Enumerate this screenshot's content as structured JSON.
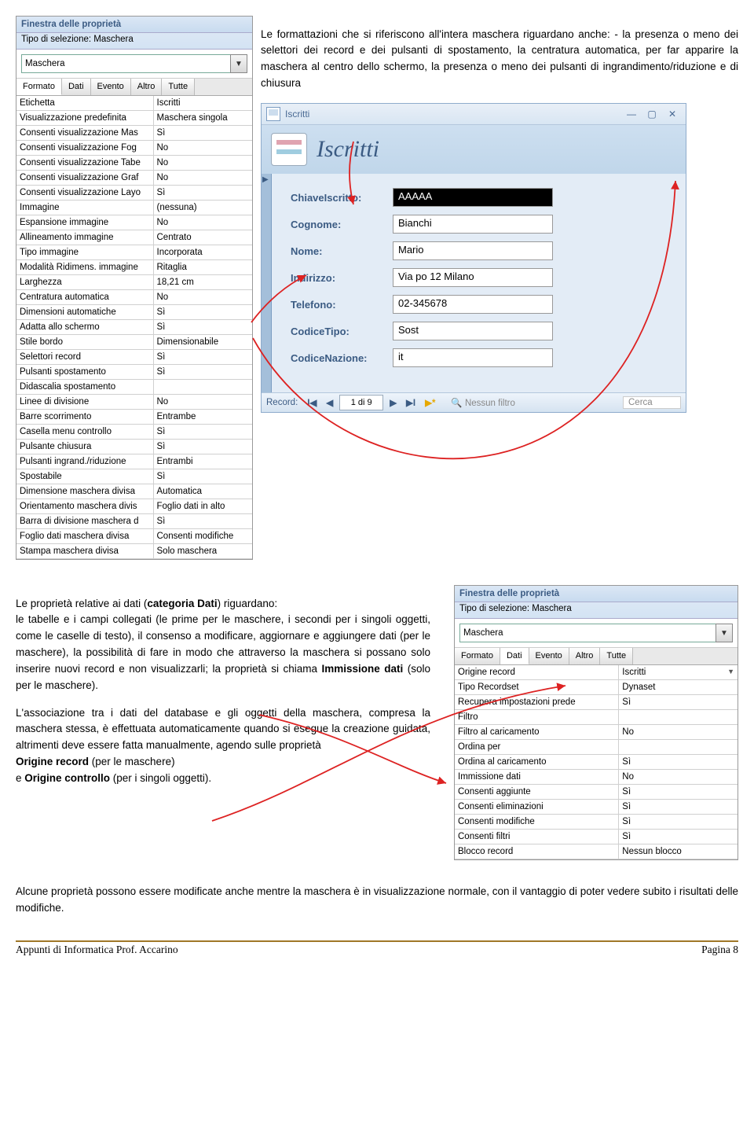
{
  "prop1": {
    "title": "Finestra delle proprietà",
    "subtitle": "Tipo di selezione:  Maschera",
    "select_value": "Maschera",
    "tabs": [
      "Formato",
      "Dati",
      "Evento",
      "Altro",
      "Tutte"
    ],
    "active_tab": 0,
    "rows": [
      [
        "Etichetta",
        "Iscritti"
      ],
      [
        "Visualizzazione predefinita",
        "Maschera singola"
      ],
      [
        "Consenti visualizzazione Mas",
        "Sì"
      ],
      [
        "Consenti visualizzazione Fog",
        "No"
      ],
      [
        "Consenti visualizzazione Tabe",
        "No"
      ],
      [
        "Consenti visualizzazione Graf",
        "No"
      ],
      [
        "Consenti visualizzazione Layo",
        "Sì"
      ],
      [
        "Immagine",
        "(nessuna)"
      ],
      [
        "Espansione immagine",
        "No"
      ],
      [
        "Allineamento immagine",
        "Centrato"
      ],
      [
        "Tipo immagine",
        "Incorporata"
      ],
      [
        "Modalità Ridimens. immagine",
        "Ritaglia"
      ],
      [
        "Larghezza",
        "18,21 cm"
      ],
      [
        "Centratura automatica",
        "No"
      ],
      [
        "Dimensioni automatiche",
        "Sì"
      ],
      [
        "Adatta allo schermo",
        "Sì"
      ],
      [
        "Stile bordo",
        "Dimensionabile"
      ],
      [
        "Selettori record",
        "Sì"
      ],
      [
        "Pulsanti spostamento",
        "Sì"
      ],
      [
        "Didascalia spostamento",
        ""
      ],
      [
        "Linee di divisione",
        "No"
      ],
      [
        "Barre scorrimento",
        "Entrambe"
      ],
      [
        "Casella menu controllo",
        "Sì"
      ],
      [
        "Pulsante chiusura",
        "Sì"
      ],
      [
        "Pulsanti ingrand./riduzione",
        "Entrambi"
      ],
      [
        "Spostabile",
        "Sì"
      ],
      [
        "Dimensione maschera divisa",
        "Automatica"
      ],
      [
        "Orientamento maschera divis",
        "Foglio dati in alto"
      ],
      [
        "Barra di divisione maschera d",
        "Sì"
      ],
      [
        "Foglio dati maschera divisa",
        "Consenti modifiche"
      ],
      [
        "Stampa maschera divisa",
        "Solo maschera"
      ]
    ]
  },
  "para1": "Le formattazioni che si riferiscono all'intera maschera riguardano anche: - la presenza o meno dei selettori dei record e dei pulsanti di spostamento, la centratura automatica, per far apparire la maschera al centro dello schermo, la presenza o meno dei pulsanti di ingrandimento/riduzione e di chiusura",
  "form": {
    "tab_title": "Iscritti",
    "header_title": "Iscritti",
    "fields": [
      {
        "label": "ChiaveIscritto:",
        "value": "AAAAA",
        "highlight": true
      },
      {
        "label": "Cognome:",
        "value": "Bianchi"
      },
      {
        "label": "Nome:",
        "value": "Mario"
      },
      {
        "label": "Indirizzo:",
        "value": "Via po 12 Milano"
      },
      {
        "label": "Telefono:",
        "value": "02-345678"
      },
      {
        "label": "CodiceTipo:",
        "value": "Sost"
      },
      {
        "label": "CodiceNazione:",
        "value": "it"
      }
    ],
    "record_label": "Record:",
    "record_pos": "1 di 9",
    "filter_label": "Nessun filtro",
    "search_label": "Cerca"
  },
  "para2_a": "Le proprietà relative ai dati (",
  "para2_b": "categoria Dati",
  "para2_c": ") riguardano:",
  "para2_2": "le tabelle e i campi collegati (le prime per le maschere, i secondi per i singoli oggetti, come le caselle di testo), il consenso a modificare, aggiornare e aggiungere dati (per le maschere), la possibilità di fare in modo che attraverso la maschera si possano solo inserire nuovi record e non visualizzarli; la proprietà si chiama ",
  "para2_2b": "Immissione dati",
  "para2_2c": " (solo per le maschere).",
  "para3_a": "L'associazione tra i dati del database e gli oggetti della maschera, compresa la maschera stessa, è effettuata automaticamente quando si esegue la creazione guidata, altrimenti deve essere fatta manualmente, agendo sulle proprietà",
  "para3_b": "Origine record",
  "para3_c": " (per le maschere)",
  "para3_d": "e ",
  "para3_e": "Origine controllo",
  "para3_f": " (per i singoli oggetti).",
  "para4": "Alcune proprietà possono essere modificate anche mentre la maschera è in visualizzazione normale, con il vantaggio di poter vedere subito i risultati delle modifiche.",
  "prop2": {
    "title": "Finestra delle proprietà",
    "subtitle": "Tipo di selezione:  Maschera",
    "select_value": "Maschera",
    "tabs": [
      "Formato",
      "Dati",
      "Evento",
      "Altro",
      "Tutte"
    ],
    "active_tab": 1,
    "rows": [
      [
        "Origine record",
        "Iscritti"
      ],
      [
        "Tipo Recordset",
        "Dynaset"
      ],
      [
        "Recupera impostazioni prede",
        "Sì"
      ],
      [
        "Filtro",
        ""
      ],
      [
        "Filtro al caricamento",
        "No"
      ],
      [
        "Ordina per",
        ""
      ],
      [
        "Ordina al caricamento",
        "Sì"
      ],
      [
        "Immissione dati",
        "No"
      ],
      [
        "Consenti aggiunte",
        "Sì"
      ],
      [
        "Consenti eliminazioni",
        "Sì"
      ],
      [
        "Consenti modifiche",
        "Sì"
      ],
      [
        "Consenti filtri",
        "Sì"
      ],
      [
        "Blocco record",
        "Nessun blocco"
      ]
    ]
  },
  "footer_left": "Appunti di Informatica Prof. Accarino",
  "footer_right": "Pagina 8"
}
